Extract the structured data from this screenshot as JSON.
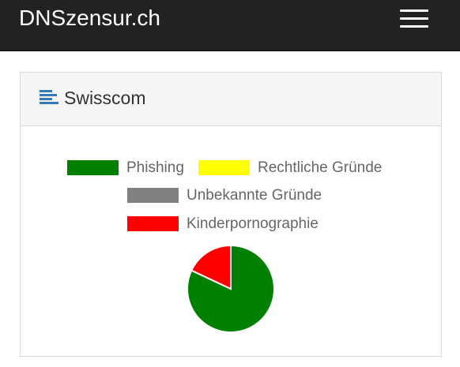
{
  "navbar": {
    "brand": "DNSzensur.ch",
    "menu_icon": "hamburger-menu-icon"
  },
  "panel": {
    "icon": "list-align-left-icon",
    "title": "Swisscom"
  },
  "chart_data": {
    "type": "pie",
    "title": "",
    "legend_position": "top",
    "slices": [
      {
        "label": "Phishing",
        "value": 82,
        "color": "#008000"
      },
      {
        "label": "Rechtliche Gründe",
        "value": 0,
        "color": "#ffff00"
      },
      {
        "label": "Unbekannte Gründe",
        "value": 0,
        "color": "#808080"
      },
      {
        "label": "Kinderpornographie",
        "value": 18,
        "color": "#ff0000"
      }
    ]
  }
}
